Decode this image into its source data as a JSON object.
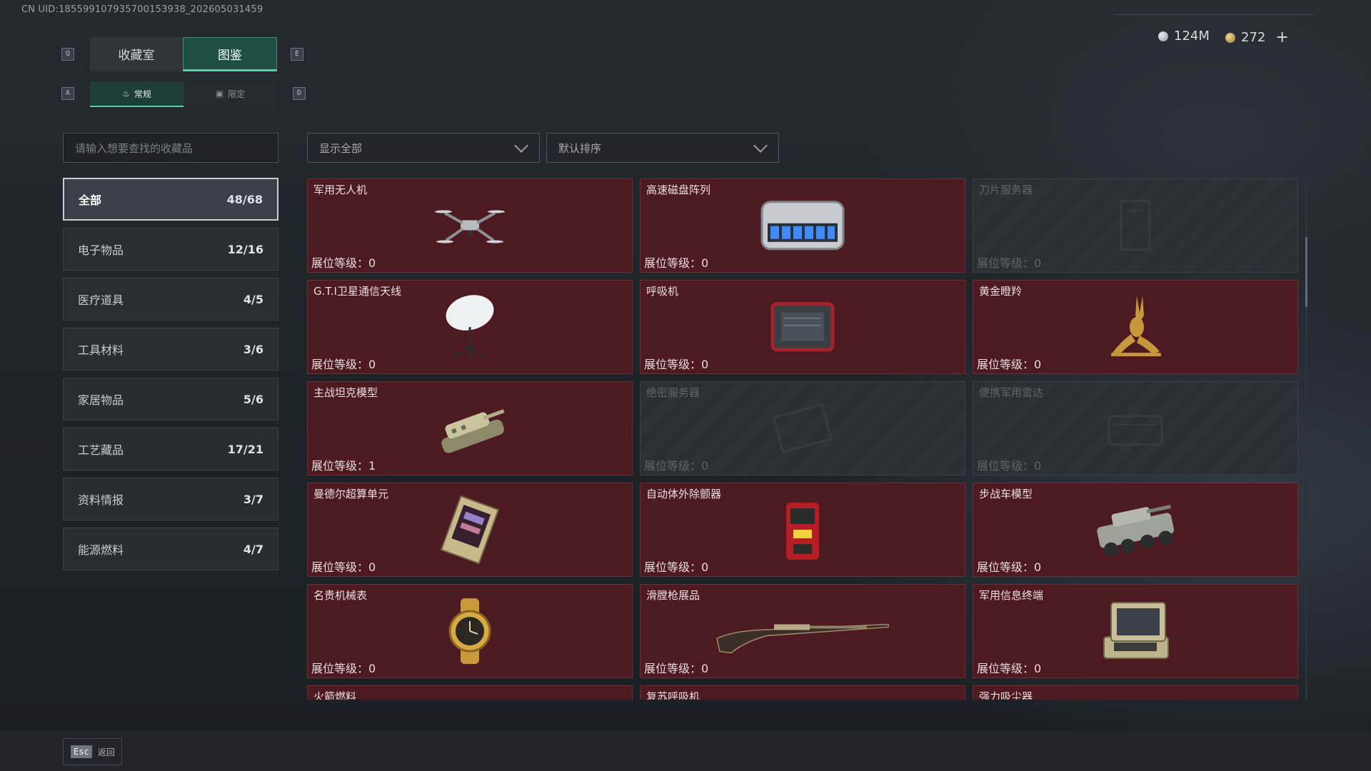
{
  "uid": "CN UID:18559910793570015393​8_202605031459",
  "keys": {
    "q": "Q",
    "e": "E",
    "a": "A",
    "d": "D"
  },
  "tabs": {
    "collection": "收藏室",
    "catalog": "图鉴"
  },
  "subtabs": {
    "normal": "常规",
    "limited": "限定"
  },
  "currency": {
    "silver": "124M",
    "gold": "272",
    "plus": "+"
  },
  "search": {
    "placeholder": "请输入想要查找的收藏品"
  },
  "filters": {
    "show": "显示全部",
    "sort": "默认排序"
  },
  "categories": [
    {
      "label": "全部",
      "count": "48/68"
    },
    {
      "label": "电子物品",
      "count": "12/16"
    },
    {
      "label": "医疗道具",
      "count": "4/5"
    },
    {
      "label": "工具材料",
      "count": "3/6"
    },
    {
      "label": "家居物品",
      "count": "5/6"
    },
    {
      "label": "工艺藏品",
      "count": "17/21"
    },
    {
      "label": "资料情报",
      "count": "3/7"
    },
    {
      "label": "能源燃料",
      "count": "4/7"
    }
  ],
  "items": [
    {
      "name": "军用无人机",
      "level": "展位等级：0",
      "icon": "drone-icon"
    },
    {
      "name": "高速磁盘阵列",
      "level": "展位等级：0",
      "icon": "disk-array-icon"
    },
    {
      "name": "刀片服务器",
      "level": "展位等级：0",
      "icon": "blade-server-icon"
    },
    {
      "name": "G.T.I卫星通信天线",
      "level": "展位等级：0",
      "icon": "satellite-dish-icon"
    },
    {
      "name": "呼吸机",
      "level": "展位等级：0",
      "icon": "ventilator-icon"
    },
    {
      "name": "黄金瞪羚",
      "level": "展位等级：0",
      "icon": "gazelle-icon"
    },
    {
      "name": "主战坦克模型",
      "level": "展位等级：1",
      "icon": "tank-icon"
    },
    {
      "name": "绝密服务器",
      "level": "展位等级：0",
      "icon": "server-icon"
    },
    {
      "name": "便携军用雷达",
      "level": "展位等级：0",
      "icon": "radar-icon"
    },
    {
      "name": "曼德尔超算单元",
      "level": "展位等级：0",
      "icon": "supercomputer-icon"
    },
    {
      "name": "自动体外除颤器",
      "level": "展位等级：0",
      "icon": "defibrillator-icon"
    },
    {
      "name": "步战车模型",
      "level": "展位等级：0",
      "icon": "ifv-icon"
    },
    {
      "name": "名贵机械表",
      "level": "展位等级：0",
      "icon": "watch-icon"
    },
    {
      "name": "滑膛枪展品",
      "level": "展位等级：0",
      "icon": "musket-icon"
    },
    {
      "name": "军用信息终端",
      "level": "展位等级：0",
      "icon": "terminal-icon"
    },
    {
      "name": "火箭燃料",
      "level": "",
      "icon": "rocket-fuel-icon"
    },
    {
      "name": "复苏呼吸机",
      "level": "",
      "icon": "resus-ventilator-icon"
    },
    {
      "name": "强力吸尘器",
      "level": "",
      "icon": "vacuum-icon"
    }
  ],
  "footer": {
    "esc_key": "Esc",
    "esc_label": "返回"
  }
}
